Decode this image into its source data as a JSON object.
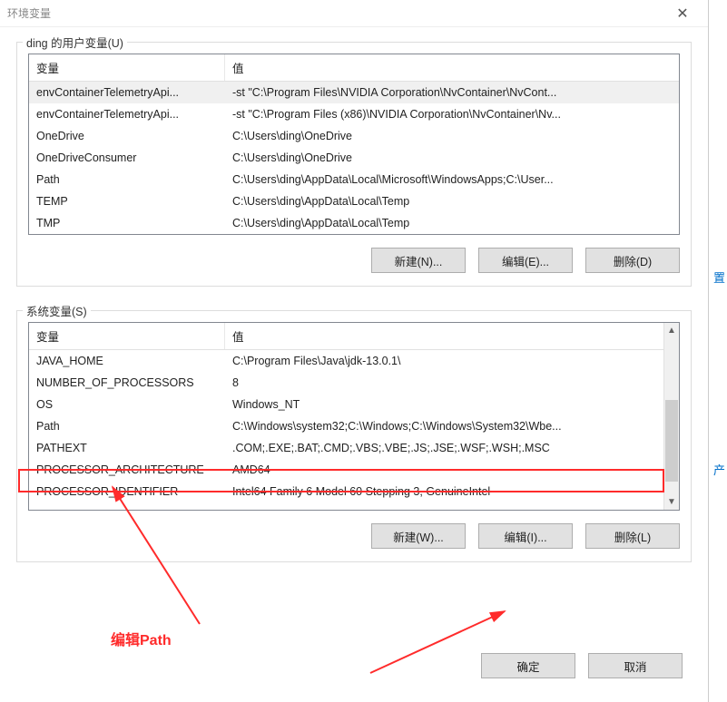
{
  "title": "环境变量",
  "user_group_legend": "ding 的用户变量(U)",
  "sys_group_legend": "系统变量(S)",
  "headers": {
    "variable": "变量",
    "value": "值"
  },
  "user_vars": [
    {
      "name": "envContainerTelemetryApi...",
      "value": "-st \"C:\\Program Files\\NVIDIA Corporation\\NvContainer\\NvCont...",
      "sel": true
    },
    {
      "name": "envContainerTelemetryApi...",
      "value": "-st \"C:\\Program Files (x86)\\NVIDIA Corporation\\NvContainer\\Nv..."
    },
    {
      "name": "OneDrive",
      "value": "C:\\Users\\ding\\OneDrive"
    },
    {
      "name": "OneDriveConsumer",
      "value": "C:\\Users\\ding\\OneDrive"
    },
    {
      "name": "Path",
      "value": "C:\\Users\\ding\\AppData\\Local\\Microsoft\\WindowsApps;C:\\User..."
    },
    {
      "name": "TEMP",
      "value": "C:\\Users\\ding\\AppData\\Local\\Temp"
    },
    {
      "name": "TMP",
      "value": "C:\\Users\\ding\\AppData\\Local\\Temp"
    }
  ],
  "sys_vars": [
    {
      "name": "JAVA_HOME",
      "value": "C:\\Program Files\\Java\\jdk-13.0.1\\"
    },
    {
      "name": "NUMBER_OF_PROCESSORS",
      "value": "8"
    },
    {
      "name": "OS",
      "value": "Windows_NT"
    },
    {
      "name": "Path",
      "value": "C:\\Windows\\system32;C:\\Windows;C:\\Windows\\System32\\Wbe...",
      "highlight": true
    },
    {
      "name": "PATHEXT",
      "value": ".COM;.EXE;.BAT;.CMD;.VBS;.VBE;.JS;.JSE;.WSF;.WSH;.MSC"
    },
    {
      "name": "PROCESSOR_ARCHITECTURE",
      "value": "AMD64"
    },
    {
      "name": "PROCESSOR_IDENTIFIER",
      "value": "Intel64 Family 6 Model 60 Stepping 3, GenuineIntel"
    }
  ],
  "buttons": {
    "user_new": "新建(N)...",
    "user_edit": "编辑(E)...",
    "user_delete": "删除(D)",
    "sys_new": "新建(W)...",
    "sys_edit": "编辑(I)...",
    "sys_delete": "删除(L)",
    "ok": "确定",
    "cancel": "取消"
  },
  "annotation": "编辑Path",
  "side1": "置",
  "side2": "产"
}
